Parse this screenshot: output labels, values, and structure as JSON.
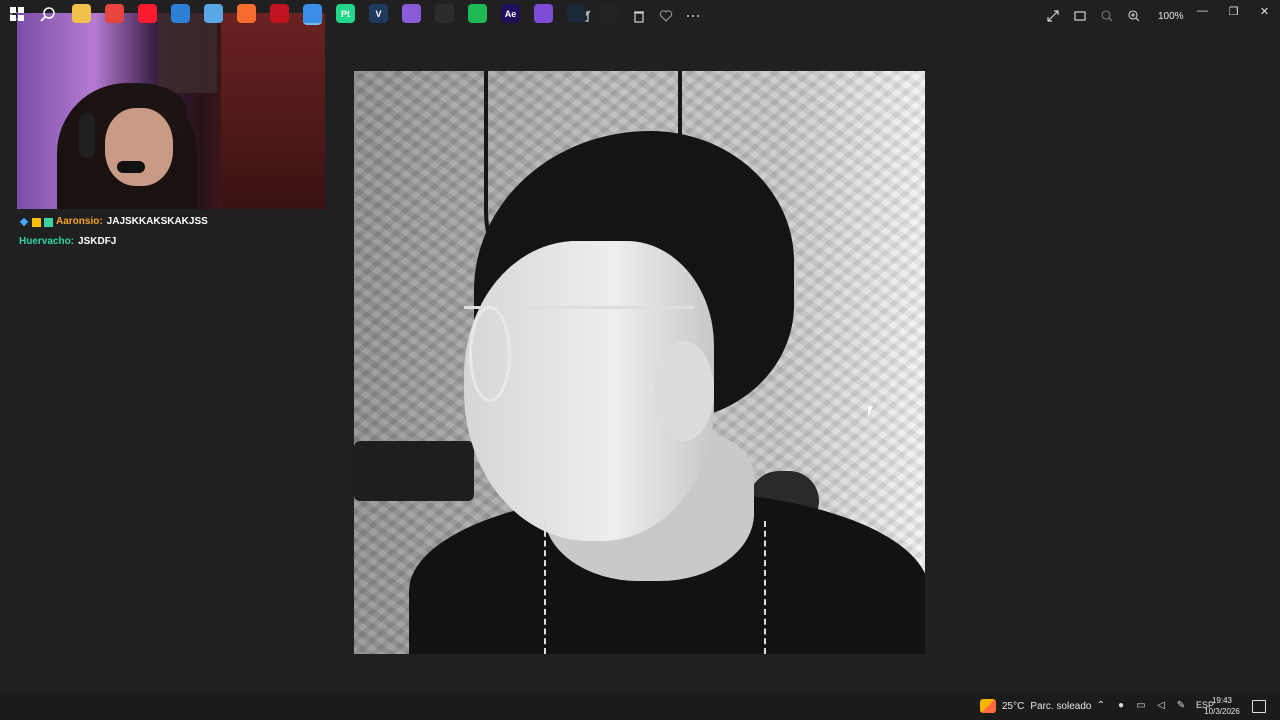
{
  "toolbar": {
    "center_icons": [
      "edit-image-icon",
      "rotate-icon",
      "delete-icon",
      "favorite-icon",
      "more-icon"
    ],
    "zoom_label": "100%"
  },
  "chat": [
    {
      "user": "Aaronsio:",
      "message": "JAJSKKAKSKAKJSS",
      "user_color": "#f5a623"
    },
    {
      "user": "Huervacho:",
      "message": "JSKDFJ",
      "user_color": "#2fd3a4"
    }
  ],
  "taskbar": {
    "weather": {
      "temp": "25°C",
      "text": "Parc. soleado"
    },
    "language": "ESP",
    "time": "19:43",
    "date": "10/3/2026",
    "pinned": [
      {
        "name": "file-explorer-icon",
        "color": "#f0c24b",
        "label": ""
      },
      {
        "name": "chrome-icon",
        "color": "#e8453c",
        "label": ""
      },
      {
        "name": "opera-icon",
        "color": "#ff1b2d",
        "label": ""
      },
      {
        "name": "ccleaner-icon",
        "color": "#2b7fd4",
        "label": ""
      },
      {
        "name": "swirl-app-icon",
        "color": "#5aa7e8",
        "label": ""
      },
      {
        "name": "origin-icon",
        "color": "#f56c2d",
        "label": ""
      },
      {
        "name": "voicemod-icon",
        "color": "#c1121f",
        "label": ""
      },
      {
        "name": "photos-icon",
        "color": "#3a8ee6",
        "label": ""
      },
      {
        "name": "pycharm-icon",
        "color": "#21d789",
        "label": "Pt"
      },
      {
        "name": "visual-studio-icon",
        "color": "#1e3a5f",
        "label": "V"
      },
      {
        "name": "paint-app-icon",
        "color": "#8a5bd6",
        "label": ""
      },
      {
        "name": "davinci-icon",
        "color": "#2c2c2c",
        "label": ""
      },
      {
        "name": "spotify-icon",
        "color": "#1db954",
        "label": ""
      },
      {
        "name": "after-effects-icon",
        "color": "#1f0f5c",
        "label": "Ae"
      },
      {
        "name": "discord-icon",
        "color": "#7d4bd6",
        "label": ""
      },
      {
        "name": "steam-icon",
        "color": "#1b2838",
        "label": ""
      },
      {
        "name": "obs-icon",
        "color": "#222222",
        "label": ""
      }
    ]
  }
}
